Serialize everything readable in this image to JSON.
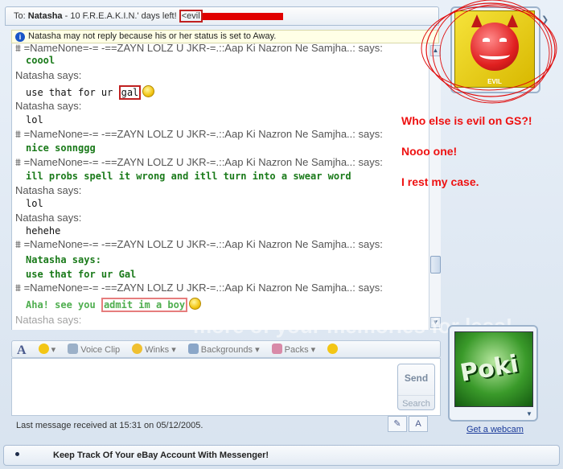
{
  "titlebar": {
    "to_label": "To:",
    "contact_name": "Natasha",
    "status_text": "- 10  F.R.E.A.K.I.N.'  days left!",
    "highlight_tag": "<evil"
  },
  "away_notice": "Natasha may not reply because his or her status is set to Away.",
  "conversation": {
    "line_1": "=NameNone=-= -==ZAYN LOLZ U JKR-=.::Aap Ki Nazron Ne Samjha..: says:",
    "msg_1": "coool",
    "says_2": "Natasha says:",
    "msg_2a": "use that for ur",
    "msg_2b": "gal",
    "says_3": "Natasha says:",
    "msg_3": "lol",
    "line_4": "=NameNone=-= -==ZAYN LOLZ U JKR-=.::Aap Ki Nazron Ne Samjha..: says:",
    "msg_4": "nice sonnggg",
    "line_5": "=NameNone=-= -==ZAYN LOLZ U JKR-=.::Aap Ki Nazron Ne Samjha..: says:",
    "msg_5": "ill probs spell it wrong and itll turn into a swear word",
    "says_6": "Natasha says:",
    "msg_6": "lol",
    "says_7": "Natasha says:",
    "msg_7": "hehehe",
    "line_8": "=NameNone=-= -==ZAYN LOLZ U JKR-=.::Aap Ki Nazron Ne Samjha..: says:",
    "says_9": "Natasha says:",
    "msg_9": "use that for ur Gal",
    "line_10": "=NameNone=-= -==ZAYN LOLZ U JKR-=.::Aap Ki Nazron Ne Samjha..: says:",
    "msg_10a": "Aha! see you",
    "msg_10b": "admit im a boy",
    "says_11": "Natasha says:"
  },
  "annotations": {
    "note_1": "Who else is evil on GS?!",
    "note_2": "Nooo one!",
    "note_3": "I rest my case."
  },
  "toolbar": {
    "font_label": "A",
    "voice_clip": "Voice Clip",
    "winks": "Winks",
    "backgrounds": "Backgrounds",
    "packs": "Packs"
  },
  "buttons": {
    "send": "Send",
    "search": "Search"
  },
  "status_line": "Last message received at 15:31 on 05/12/2005.",
  "avatar": {
    "label": "EVIL"
  },
  "webcam": {
    "link": "Get a webcam",
    "image_text": "Poki"
  },
  "ad_bar": "Keep Track Of Your eBay Account With Messenger!",
  "watermark": "more of your memories for less!",
  "colors": {
    "note_red": "#ee1111",
    "msg_green": "#1a7a1a",
    "accent_blue": "#1a56c8"
  }
}
